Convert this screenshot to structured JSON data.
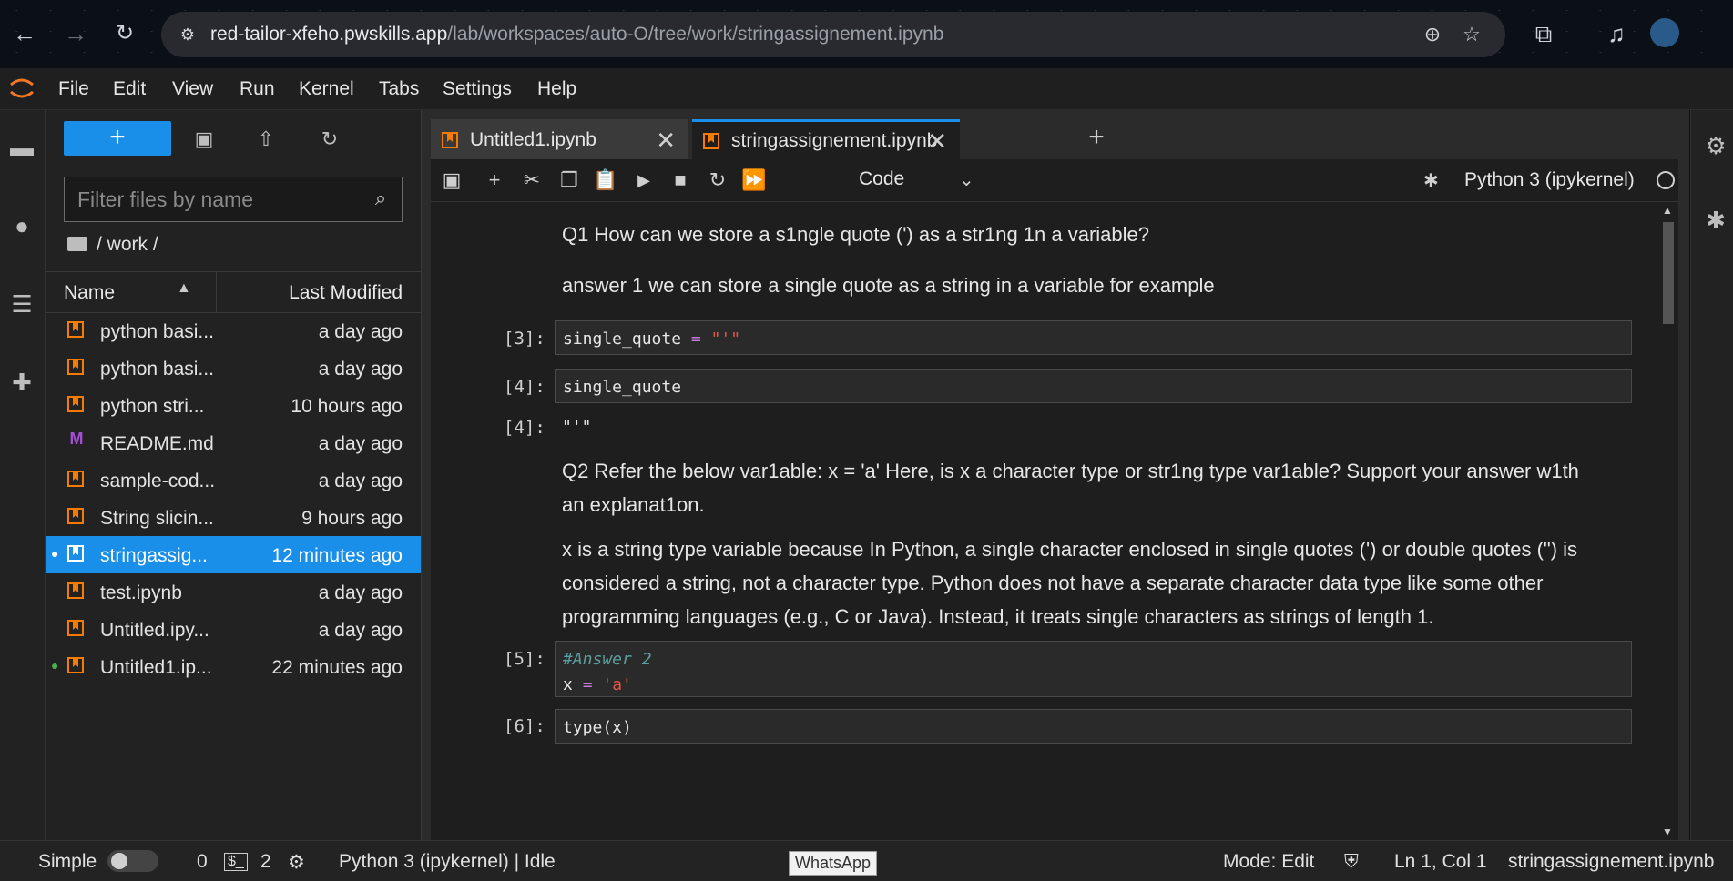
{
  "browser": {
    "url_host": "red-tailor-xfeho.pwskills.app",
    "url_path": "/lab/workspaces/auto-O/tree/work/stringassignement.ipynb"
  },
  "menu": [
    "File",
    "Edit",
    "View",
    "Run",
    "Kernel",
    "Tabs",
    "Settings",
    "Help"
  ],
  "filebrowser": {
    "filter_placeholder": "Filter files by name",
    "breadcrumb": "/ work /",
    "col_name": "Name",
    "col_modified": "Last Modified",
    "files": [
      {
        "name": "python basi...",
        "modified": "a day ago",
        "type": "notebook",
        "running": false,
        "selected": false
      },
      {
        "name": "python basi...",
        "modified": "a day ago",
        "type": "notebook",
        "running": false,
        "selected": false
      },
      {
        "name": "python stri...",
        "modified": "10 hours ago",
        "type": "notebook",
        "running": false,
        "selected": false
      },
      {
        "name": "README.md",
        "modified": "a day ago",
        "type": "markdown",
        "running": false,
        "selected": false
      },
      {
        "name": "sample-cod...",
        "modified": "a day ago",
        "type": "notebook",
        "running": false,
        "selected": false
      },
      {
        "name": "String slicin...",
        "modified": "9 hours ago",
        "type": "notebook",
        "running": false,
        "selected": false
      },
      {
        "name": "stringassig...",
        "modified": "12 minutes ago",
        "type": "notebook",
        "running": true,
        "selected": true
      },
      {
        "name": "test.ipynb",
        "modified": "a day ago",
        "type": "notebook",
        "running": false,
        "selected": false
      },
      {
        "name": "Untitled.ipy...",
        "modified": "a day ago",
        "type": "notebook",
        "running": false,
        "selected": false
      },
      {
        "name": "Untitled1.ip...",
        "modified": "22 minutes ago",
        "type": "notebook",
        "running": true,
        "selected": false
      }
    ]
  },
  "tabs": [
    {
      "label": "Untitled1.ipynb",
      "active": false
    },
    {
      "label": "stringassignement.ipynb",
      "active": true
    }
  ],
  "toolbar": {
    "cell_type": "Code",
    "kernel": "Python 3 (ipykernel)"
  },
  "notebook": {
    "md1": "Q1 How can we store a s1ngle quote (') as a str1ng 1n a variable?",
    "md2": "answer 1 we can store a single quote as a string in a variable for example",
    "p3": "[3]:",
    "c3_var": "single_quote",
    "c3_op": "=",
    "c3_str": "\"'\"",
    "p4": "[4]:",
    "c4": "single_quote",
    "p4out": "[4]:",
    "out4": "\"'\"",
    "md3": "Q2 Refer the below var1able: x = 'a' Here, is x a character type or str1ng type var1able? Support your answer w1th an explanat1on.",
    "md4": "x is a string type variable because In Python, a single character enclosed in single quotes (') or double quotes (\") is considered a string, not a character type. Python does not have a separate character data type like some other programming languages (e.g., C or Java). Instead, it treats single characters as strings of length 1.",
    "p5": "[5]:",
    "c5_comment": "#Answer 2",
    "c5_var": "x",
    "c5_op": "=",
    "c5_str": "'a'",
    "p6": "[6]:",
    "c6": "type(x)"
  },
  "status": {
    "mode_label": "Simple",
    "terminals": "0",
    "kernels": "2",
    "kernel_state": "Python 3 (ipykernel) | Idle",
    "tooltip": "WhatsApp",
    "mode": "Mode: Edit",
    "cursor": "Ln 1, Col 1",
    "filename": "stringassignement.ipynb"
  }
}
